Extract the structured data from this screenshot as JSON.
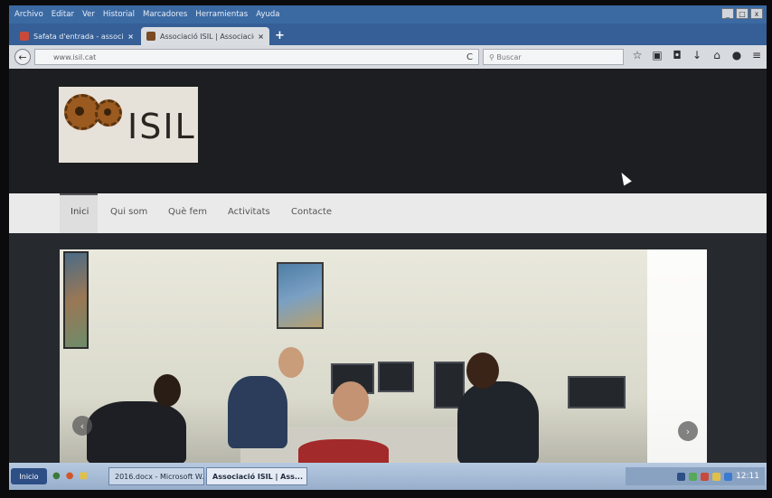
{
  "menubar": {
    "items": [
      "Archivo",
      "Editar",
      "Ver",
      "Historial",
      "Marcadores",
      "Herramientas",
      "Ayuda"
    ]
  },
  "tabs": [
    {
      "title": "Safata d'entrada - associacioi...",
      "close": "×"
    },
    {
      "title": "Associació ISIL | Associació p...",
      "close": "×"
    }
  ],
  "newtab": "+",
  "navbar": {
    "back": "←",
    "url": "www.isil.cat",
    "reload": "C",
    "search_placeholder": "Buscar",
    "icons": [
      "star-icon",
      "clipboard-icon",
      "pocket-icon",
      "download-icon",
      "home-icon",
      "chat-icon",
      "menu-icon"
    ]
  },
  "site": {
    "logo_text": "ISIL",
    "nav": [
      "Inici",
      "Qui som",
      "Què fem",
      "Activitats",
      "Contacte"
    ],
    "active_nav": "Inici",
    "slider_prev": "‹",
    "slider_next": "›"
  },
  "taskbar": {
    "start": "Inicio",
    "items": [
      "2016.docx - Microsoft W...",
      "Associació ISIL | Ass..."
    ],
    "clock": "12:11"
  },
  "colors": {
    "menubar": "#3b6aa3",
    "tabstrip": "#355f96",
    "header": "#1c1e21",
    "nav": "#eaeaea"
  }
}
